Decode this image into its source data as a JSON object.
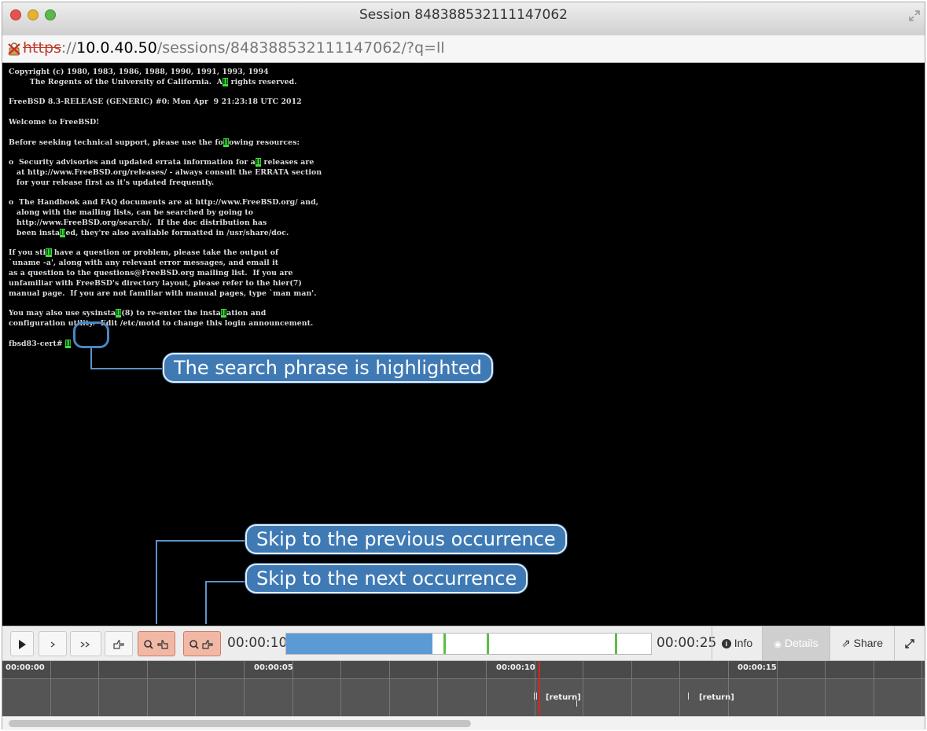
{
  "window": {
    "title": "Session 848388532111147062"
  },
  "address_bar": {
    "scheme": "https",
    "host_prefix": "://",
    "host": "10.0.40.50",
    "path": "/sessions/848388532111147062/?q=ll"
  },
  "terminal": {
    "lines": [
      "Copyright (c) 1980, 1983, 1986, 1988, 1990, 1991, 1993, 1994",
      "        The Regents of the University of California.  All rights reserved.",
      "",
      "FreeBSD 8.3-RELEASE (GENERIC) #0: Mon Apr  9 21:23:18 UTC 2012",
      "",
      "Welcome to FreeBSD!",
      "",
      "Before seeking technical support, please use the following resources:",
      "",
      "o  Security advisories and updated errata information for all releases are",
      "   at http://www.FreeBSD.org/releases/ - always consult the ERRATA section",
      "   for your release first as it's updated frequently.",
      "",
      "o  The Handbook and FAQ documents are at http://www.FreeBSD.org/ and,",
      "   along with the mailing lists, can be searched by going to",
      "   http://www.FreeBSD.org/search/.  If the doc distribution has",
      "   been installed, they're also available formatted in /usr/share/doc.",
      "",
      "If you still have a question or problem, please take the output of",
      "`uname -a', along with any relevant error messages, and email it",
      "as a question to the questions@FreeBSD.org mailing list.  If you are",
      "unfamiliar with FreeBSD's directory layout, please refer to the hier(7)",
      "manual page.  If you are not familiar with manual pages, type `man man'.",
      "",
      "You may also use sysinstall(8) to re-enter the installation and",
      "configuration utility.  Edit /etc/motd to change this login announcement.",
      "",
      "fbsd83-cert# ll"
    ],
    "highlight_term": "ll"
  },
  "callouts": {
    "highlighted": "The search phrase is highlighted",
    "previous": "Skip to the previous occurrence",
    "next": "Skip to the next occurrence"
  },
  "player": {
    "play_icon": "play-icon",
    "fast_icon": "fast-forward-icon",
    "faster_icon": "fastest-forward-icon",
    "current_time": "00:00:10",
    "end_time": "00:00:25",
    "progress_fraction": 0.4,
    "occurrence_marks": [
      0.43,
      0.55,
      0.9
    ],
    "tabs": {
      "info": "Info",
      "details": "Details",
      "share": "Share"
    }
  },
  "timeline": {
    "labels": [
      "00:00:00",
      "00:00:05",
      "00:00:10",
      "00:00:15"
    ],
    "events": [
      "[return]",
      "[return]"
    ]
  },
  "colors": {
    "highlight": "#38e23a",
    "callout": "#3f7ab5",
    "search_button": "#f2b8a6",
    "progress": "#5c9ad6",
    "playhead": "#e02020"
  }
}
